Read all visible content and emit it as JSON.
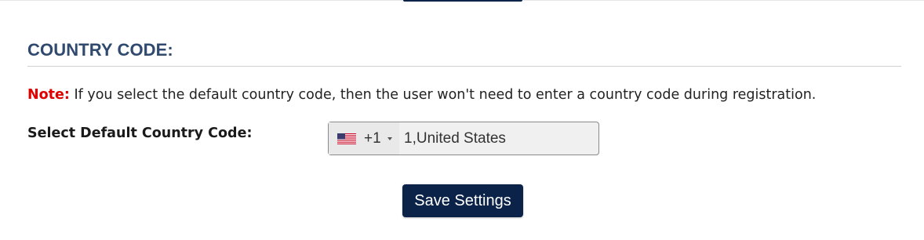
{
  "section": {
    "title": "COUNTRY CODE:"
  },
  "note": {
    "label": "Note:",
    "text": " If you select the default country code, then the user won't need to enter a country code during registration."
  },
  "default_country": {
    "label": "Select Default Country Code:",
    "flag_icon": "us-flag-icon",
    "dial_code": "+1",
    "value": "1,United States"
  },
  "actions": {
    "save_label": "Save Settings"
  },
  "colors": {
    "title": "#2f4a6e",
    "note_label": "#e00000",
    "button_bg": "#0b2348",
    "input_bg": "#f0f0f0"
  }
}
